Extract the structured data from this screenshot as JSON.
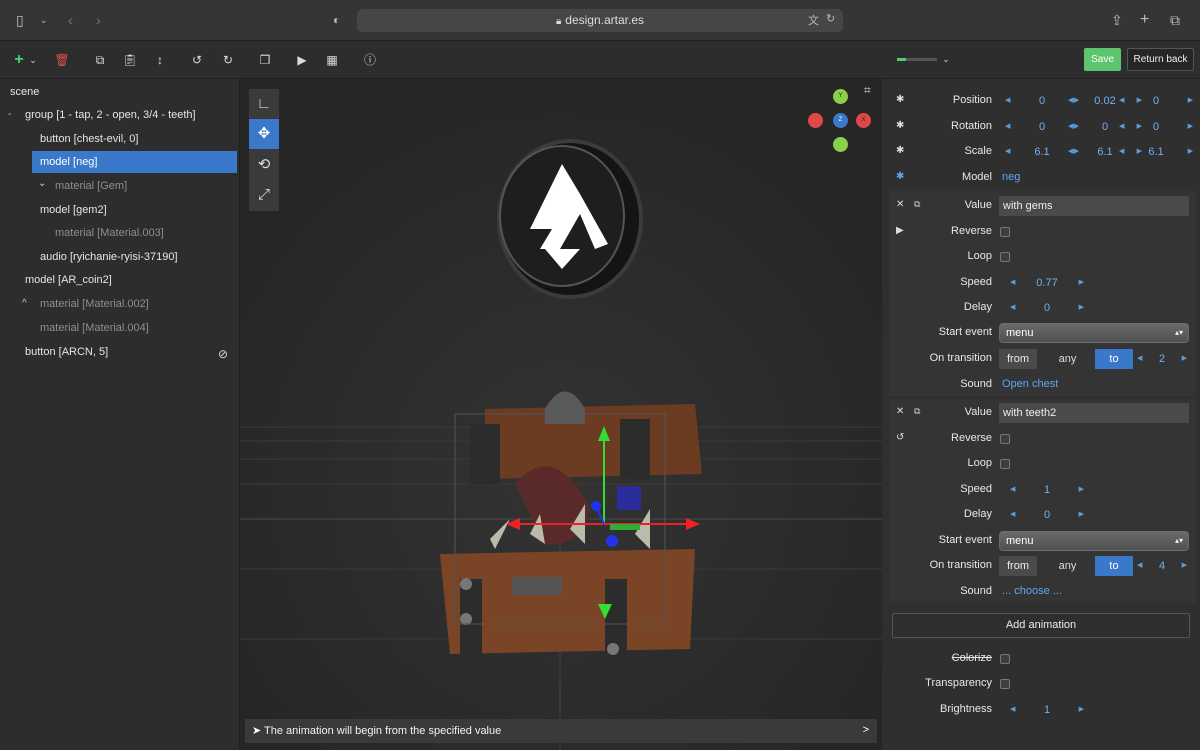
{
  "browser": {
    "url": "design.artar.es",
    "icons": [
      "sidebar-icon",
      "chevron-down-icon",
      "back-icon",
      "forward-icon",
      "shield-icon",
      "lock-icon",
      "translate-icon",
      "reload-icon",
      "share-icon",
      "new-tab-icon",
      "tabs-icon"
    ]
  },
  "toolbar": {
    "save_label": "Save",
    "return_label": "Return back",
    "progress": 0.22
  },
  "tree": {
    "root": "scene",
    "items": [
      {
        "label": "group [1 - tap, 2 - open, 3/4 - teeth]",
        "toggle": "-"
      },
      {
        "label": "button [chest-evil, 0]"
      },
      {
        "label": "model [neg]"
      },
      {
        "label": "material [Gem]",
        "toggle": "⌄"
      },
      {
        "label": "model [gem2]"
      },
      {
        "label": "material [Material.003]"
      },
      {
        "label": "audio [ryichanie-ryisi-37190]"
      },
      {
        "label": "model [AR_coin2]"
      },
      {
        "label": "material [Material.002]",
        "toggle": "^"
      },
      {
        "label": "material [Material.004]"
      },
      {
        "label": "button [ARCN, 5]"
      }
    ]
  },
  "viewport": {
    "gizmo_labels": {
      "y": "Y",
      "x": "X",
      "z": "Z"
    },
    "status_text": "The animation will begin from the specified value",
    "status_arrow": ">"
  },
  "props": {
    "position": {
      "label": "Position",
      "x": "0",
      "y": "0.02",
      "z": "0"
    },
    "rotation": {
      "label": "Rotation",
      "x": "0",
      "y": "0",
      "z": "0"
    },
    "scale": {
      "label": "Scale",
      "x": "6.1",
      "y": "6.1",
      "z": "6.1"
    },
    "model": {
      "label": "Model",
      "value": "neg"
    },
    "labels": {
      "value": "Value",
      "reverse": "Reverse",
      "loop": "Loop",
      "speed": "Speed",
      "delay": "Delay",
      "start_event": "Start event",
      "on_transition": "On transition",
      "sound": "Sound",
      "from": "from",
      "any": "any",
      "to": "to"
    },
    "anim1": {
      "value": "with gems",
      "speed": "0.77",
      "delay": "0",
      "start_event": "menu",
      "to_value": "2",
      "sound": "Open chest"
    },
    "anim2": {
      "value": "with teeth2",
      "speed": "1",
      "delay": "0",
      "start_event": "menu",
      "to_value": "4",
      "sound": "... choose ..."
    },
    "add_animation": "Add animation",
    "colorize": "Colorize",
    "transparency": "Transparency",
    "brightness": {
      "label": "Brightness",
      "value": "1"
    }
  },
  "colors": {
    "accent": "#3a78c9",
    "save": "#5cc56e",
    "delete": "#e05050",
    "add": "#4cd16a",
    "link": "#5ea7f5"
  }
}
